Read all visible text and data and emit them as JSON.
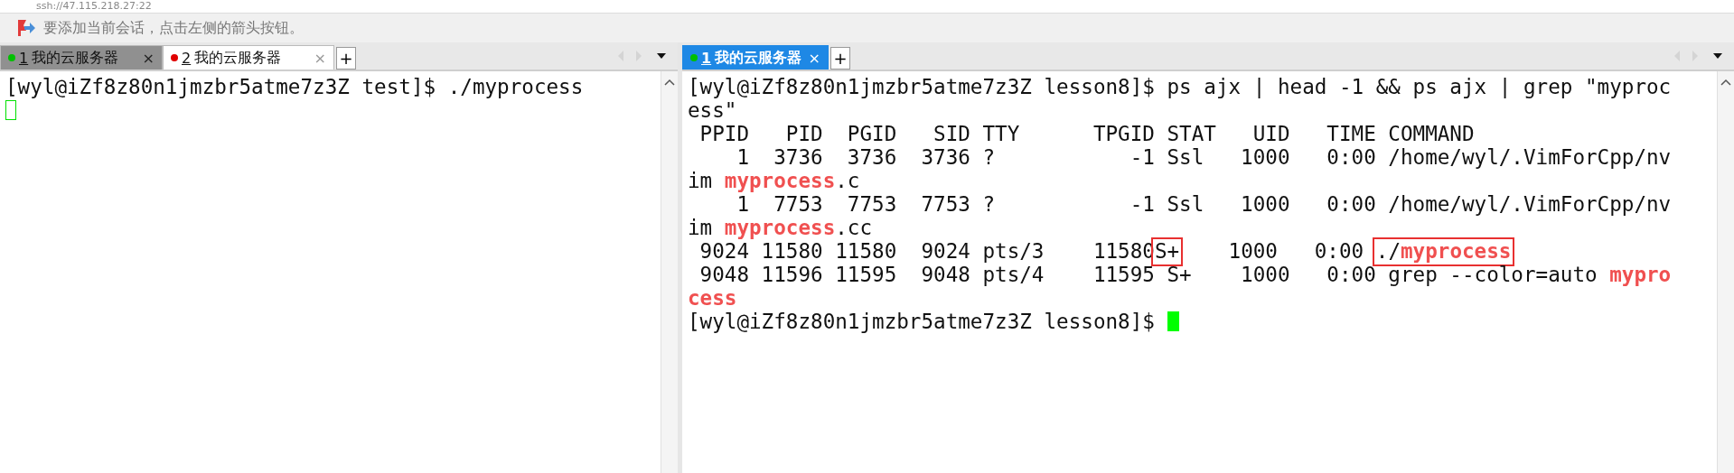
{
  "address_bar": {
    "text": "ssh://47.115.218.27:22"
  },
  "hint_bar": {
    "text": "要添加当前会话，点击左侧的箭头按钮。"
  },
  "panes": [
    {
      "focused": false,
      "tabs": [
        {
          "number": "1",
          "label": "我的云服务器",
          "close": "×",
          "color": "#00c000",
          "selected": false
        },
        {
          "number": "2",
          "label": "我的云服务器",
          "close": "×",
          "color": "#e00000",
          "selected": true
        }
      ],
      "new_tab": "+",
      "lines": [
        {
          "segments": [
            {
              "text": "[wyl@iZf8z80n1jmzbr5atme7z3Z test]$ ./myprocess",
              "kind": "normal"
            }
          ]
        },
        {
          "cursor": {
            "kind": "hollow"
          }
        }
      ]
    },
    {
      "focused": true,
      "tabs": [
        {
          "number": "1",
          "label": "我的云服务器",
          "close": "×",
          "color": "#00c000",
          "selected": true
        }
      ],
      "new_tab": "+",
      "lines": [
        {
          "segments": [
            {
              "text": "[wyl@iZf8z80n1jmzbr5atme7z3Z lesson8]$ ps ajx | head -1 && ps ajx | grep \"myproc",
              "kind": "normal"
            }
          ]
        },
        {
          "segments": [
            {
              "text": "ess\"",
              "kind": "normal"
            }
          ]
        },
        {
          "segments": [
            {
              "text": " PPID   PID  PGID   SID TTY      TPGID STAT   UID   TIME COMMAND",
              "kind": "normal"
            }
          ]
        },
        {
          "segments": [
            {
              "text": "    1  3736  3736  3736 ?           -1 Ssl   1000   0:00 /home/wyl/.VimForCpp/nv",
              "kind": "normal"
            }
          ]
        },
        {
          "segments": [
            {
              "text": "im ",
              "kind": "normal"
            },
            {
              "text": "myprocess",
              "kind": "match"
            },
            {
              "text": ".c",
              "kind": "normal"
            }
          ]
        },
        {
          "segments": [
            {
              "text": "    1  7753  7753  7753 ?           -1 Ssl   1000   0:00 /home/wyl/.VimForCpp/nv",
              "kind": "normal"
            }
          ]
        },
        {
          "segments": [
            {
              "text": "im ",
              "kind": "normal"
            },
            {
              "text": "myprocess",
              "kind": "match"
            },
            {
              "text": ".cc",
              "kind": "normal"
            }
          ]
        },
        {
          "segments": [
            {
              "text": " 9024 11580 11580  9024 pts/3    11580",
              "kind": "normal"
            },
            {
              "boxed": true,
              "segments": [
                {
                  "text": "S+",
                  "kind": "normal"
                }
              ]
            },
            {
              "text": "    1000   0:00 ",
              "kind": "normal"
            },
            {
              "boxed": true,
              "segments": [
                {
                  "text": "./",
                  "kind": "normal"
                },
                {
                  "text": "myprocess",
                  "kind": "match"
                }
              ]
            }
          ]
        },
        {
          "segments": [
            {
              "text": " 9048 11596 11595  9048 pts/4    11595 S+    1000   0:00 grep --color=auto ",
              "kind": "normal"
            },
            {
              "text": "mypro",
              "kind": "match"
            }
          ]
        },
        {
          "segments": [
            {
              "text": "cess",
              "kind": "match"
            }
          ]
        },
        {
          "segments": [
            {
              "text": "[wyl@iZf8z80n1jmzbr5atme7z3Z lesson8]$ ",
              "kind": "normal"
            }
          ],
          "cursor": {
            "kind": "block"
          }
        }
      ]
    }
  ]
}
